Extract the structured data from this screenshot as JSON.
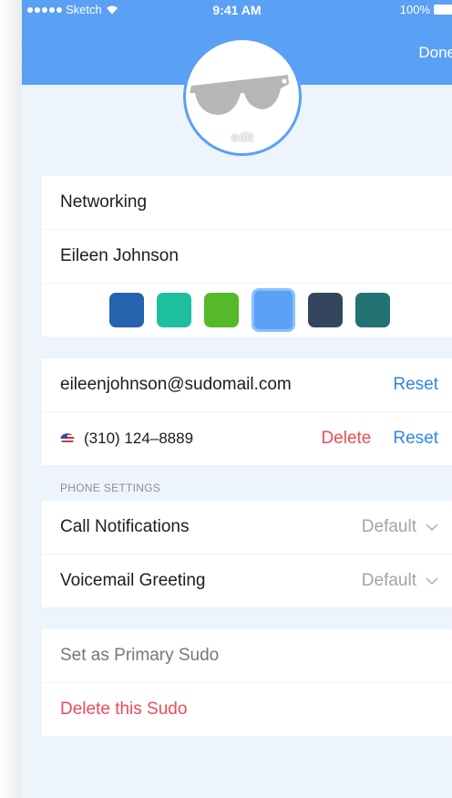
{
  "status_bar": {
    "carrier": "Sketch",
    "time": "9:41 AM",
    "battery": "100%"
  },
  "header": {
    "done_label": "Done"
  },
  "avatar": {
    "edit_label": "edit"
  },
  "profile": {
    "name_field": "Networking",
    "owner_field": "Eileen Johnson"
  },
  "colors": {
    "swatches": [
      "#2563ae",
      "#1ebf9f",
      "#55b92a",
      "#5aa2f6",
      "#34465e",
      "#237373"
    ],
    "selected_index": 3
  },
  "contact": {
    "email": "eileenjohnson@sudomail.com",
    "email_reset": "Reset",
    "phone": "(310) 124–8889",
    "phone_delete": "Delete",
    "phone_reset": "Reset"
  },
  "phone_settings": {
    "header": "PHONE SETTINGS",
    "call_notifications_label": "Call Notifications",
    "call_notifications_value": "Default",
    "voicemail_label": "Voicemail Greeting",
    "voicemail_value": "Default"
  },
  "actions": {
    "set_primary": "Set as Primary Sudo",
    "delete_sudo": "Delete this Sudo"
  },
  "accent_colors": {
    "header_blue": "#5aa0f4",
    "link_blue": "#2f86e8",
    "danger_red": "#ef4b55"
  }
}
